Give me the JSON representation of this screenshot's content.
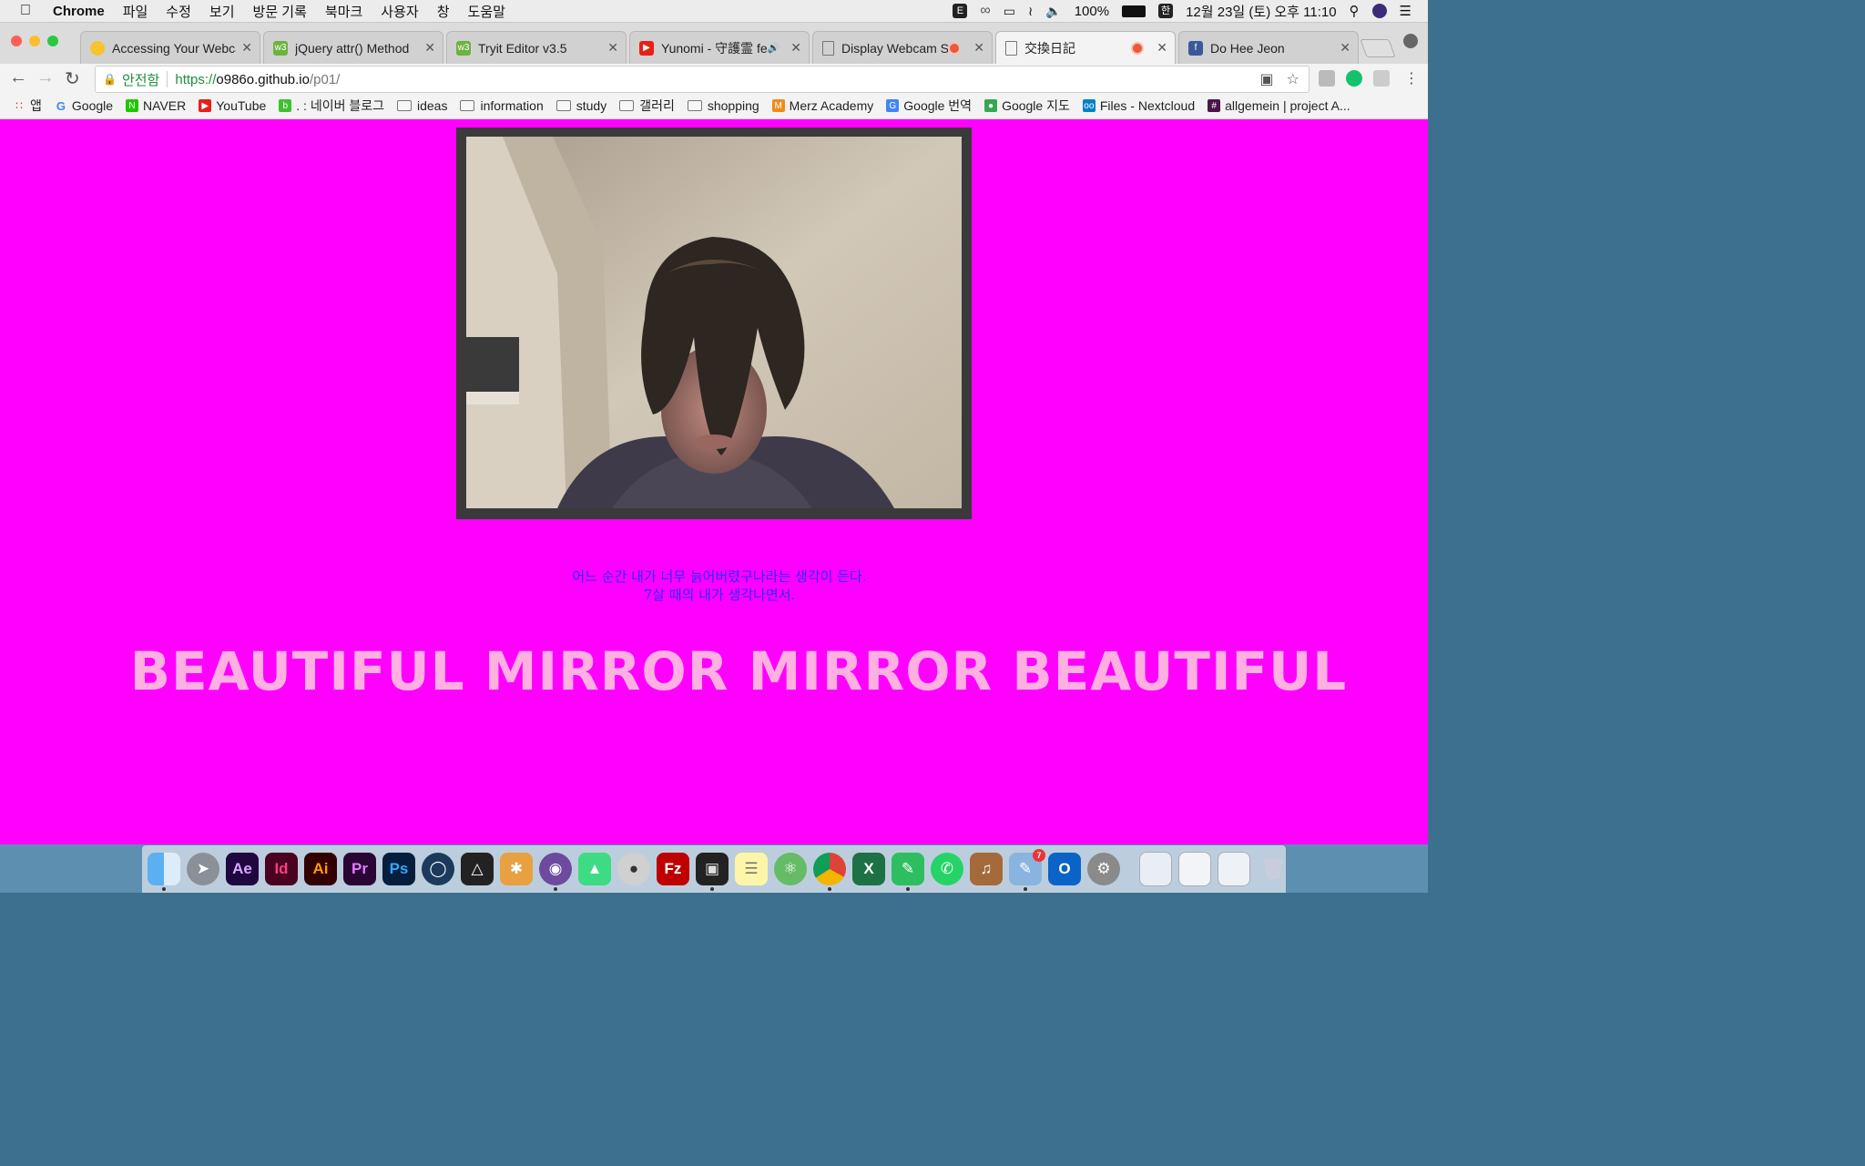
{
  "menubar": {
    "app_name": "Chrome",
    "menus": [
      "파일",
      "수정",
      "보기",
      "방문 기록",
      "북마크",
      "사용자",
      "창",
      "도움말"
    ],
    "battery": "100%",
    "input_source": "한",
    "datetime": "12월 23일 (토) 오후 11:10"
  },
  "tabs": [
    {
      "label": "Accessing Your Webca",
      "favicon": "emoji-icon",
      "recording": false,
      "muted": false,
      "active": false
    },
    {
      "label": "jQuery attr() Method",
      "favicon": "w3schools-icon",
      "recording": false,
      "muted": false,
      "active": false
    },
    {
      "label": "Tryit Editor v3.5",
      "favicon": "w3schools-icon",
      "recording": false,
      "muted": false,
      "active": false
    },
    {
      "label": "Yunomi - 守護霊 feat",
      "favicon": "youtube-icon",
      "recording": false,
      "muted": true,
      "active": false
    },
    {
      "label": "Display Webcam Str",
      "favicon": "page-icon",
      "recording": true,
      "muted": false,
      "active": false
    },
    {
      "label": "交換日記",
      "favicon": "page-icon",
      "recording": true,
      "muted": false,
      "active": true
    },
    {
      "label": "Do Hee Jeon",
      "favicon": "facebook-icon",
      "recording": false,
      "muted": false,
      "active": false
    }
  ],
  "address_bar": {
    "secure_label": "안전함",
    "protocol": "https://",
    "host": "o986o.github.io",
    "path": "/p01/"
  },
  "bookmarks": [
    {
      "label": "앱",
      "icon": "apps-grid-icon"
    },
    {
      "label": "Google",
      "icon": "google-icon"
    },
    {
      "label": "NAVER",
      "icon": "naver-icon"
    },
    {
      "label": "YouTube",
      "icon": "youtube-icon"
    },
    {
      "label": ". : 네이버 블로그",
      "icon": "naver-blog-icon"
    },
    {
      "label": "ideas",
      "icon": "folder-icon"
    },
    {
      "label": "information",
      "icon": "folder-icon"
    },
    {
      "label": "study",
      "icon": "folder-icon"
    },
    {
      "label": "갤러리",
      "icon": "folder-icon"
    },
    {
      "label": "shopping",
      "icon": "folder-icon"
    },
    {
      "label": "Merz Academy",
      "icon": "merz-icon"
    },
    {
      "label": "Google 번역",
      "icon": "google-translate-icon"
    },
    {
      "label": "Google 지도",
      "icon": "google-maps-icon"
    },
    {
      "label": "Files - Nextcloud",
      "icon": "nextcloud-icon"
    },
    {
      "label": "allgemein | project A...",
      "icon": "slack-icon"
    }
  ],
  "page": {
    "poem_line1": "어느 순간 내가 너무 늙어버렸구나라는 생각이 든다.",
    "poem_line2": "7살 때의 내가 생각나면서.",
    "headline": "BEAUTIFUL MIRROR MIRROR BEAUTIFUL",
    "background_color": "#ff00ff",
    "poem_color": "#2a2aff",
    "headline_color": "#ffb0e0"
  },
  "dock": {
    "apps": [
      {
        "label": "",
        "icon": "finder-icon"
      },
      {
        "label": "",
        "icon": "launchpad-icon"
      },
      {
        "label": "Ae",
        "icon": "after-effects-icon"
      },
      {
        "label": "Id",
        "icon": "indesign-icon"
      },
      {
        "label": "Ai",
        "icon": "illustrator-icon"
      },
      {
        "label": "Pr",
        "icon": "premiere-icon"
      },
      {
        "label": "Ps",
        "icon": "photoshop-icon"
      },
      {
        "label": "",
        "icon": "cinema4d-icon"
      },
      {
        "label": "",
        "icon": "unity-icon"
      },
      {
        "label": "",
        "icon": "cocktail-icon"
      },
      {
        "label": "",
        "icon": "github-icon"
      },
      {
        "label": "",
        "icon": "android-studio-icon"
      },
      {
        "label": "",
        "icon": "sequel-pro-icon"
      },
      {
        "label": "",
        "icon": "filezilla-icon"
      },
      {
        "label": "",
        "icon": "processing-icon"
      },
      {
        "label": "",
        "icon": "notes-icon"
      },
      {
        "label": "",
        "icon": "atom-icon"
      },
      {
        "label": "",
        "icon": "chrome-icon"
      },
      {
        "label": "",
        "icon": "excel-icon"
      },
      {
        "label": "",
        "icon": "evernote-icon"
      },
      {
        "label": "",
        "icon": "whatsapp-icon"
      },
      {
        "label": "",
        "icon": "garageband-icon"
      },
      {
        "label": "7",
        "icon": "preview-icon"
      },
      {
        "label": "",
        "icon": "outlook-icon"
      },
      {
        "label": "",
        "icon": "system-preferences-icon"
      }
    ]
  }
}
